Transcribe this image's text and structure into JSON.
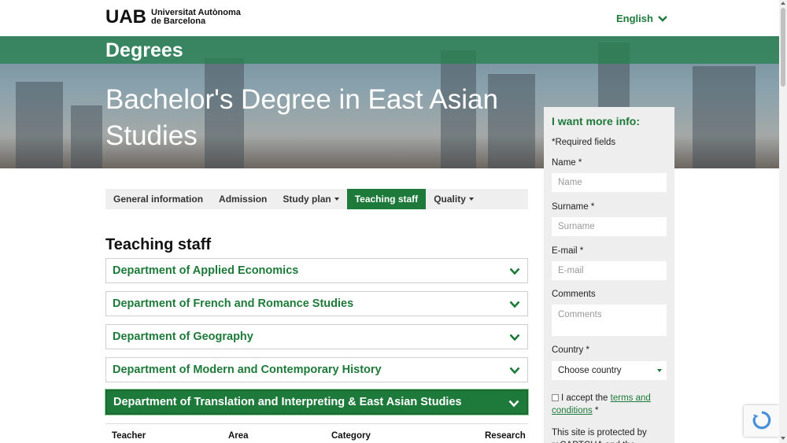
{
  "header": {
    "logo_mark": "UAB",
    "logo_line1": "Universitat Autònoma",
    "logo_line2": "de Barcelona",
    "language": "English"
  },
  "hero": {
    "section": "Degrees",
    "title": "Bachelor's Degree in East Asian Studies"
  },
  "tabs": [
    {
      "label": "General information",
      "dropdown": false,
      "active": false
    },
    {
      "label": "Admission",
      "dropdown": false,
      "active": false
    },
    {
      "label": "Study plan",
      "dropdown": true,
      "active": false
    },
    {
      "label": "Teaching staff",
      "dropdown": false,
      "active": true
    },
    {
      "label": "Quality",
      "dropdown": true,
      "active": false
    }
  ],
  "main": {
    "section_title": "Teaching staff",
    "departments": [
      {
        "label": "Department of Applied Economics",
        "expanded": false
      },
      {
        "label": "Department of French and Romance Studies",
        "expanded": false
      },
      {
        "label": "Department of Geography",
        "expanded": false
      },
      {
        "label": "Department of Modern and Contemporary History",
        "expanded": false
      },
      {
        "label": "Department of Translation and Interpreting & East Asian Studies",
        "expanded": true
      }
    ],
    "table_headers": [
      "Teacher",
      "Area",
      "Category",
      "Research"
    ]
  },
  "form": {
    "title": "I want more info:",
    "required_note": "*Required fields",
    "name_label": "Name *",
    "name_placeholder": "Name",
    "surname_label": "Surname *",
    "surname_placeholder": "Surname",
    "email_label": "E-mail *",
    "email_placeholder": "E-mail",
    "comments_label": "Comments",
    "comments_placeholder": "Comments",
    "country_label": "Country *",
    "country_value": "Choose country",
    "accept_text": "I accept the",
    "terms_link": "terms and conditions",
    "accept_suffix": "*",
    "protected_text": "This site is protected by reCAPTCHA and the Google"
  },
  "colors": {
    "accent": "#1e7a3a",
    "tab_bar_bg": "#efefef",
    "form_bg": "#eeeeee"
  }
}
